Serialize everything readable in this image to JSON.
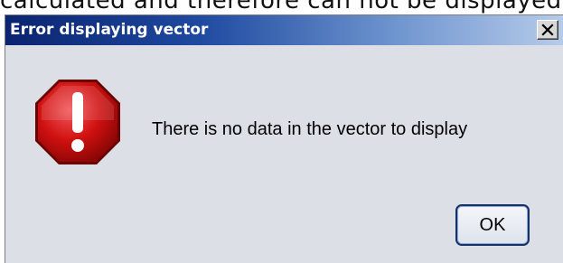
{
  "background": {
    "partial_text": "calculated and therefore can not be displayed"
  },
  "dialog": {
    "title": "Error displaying vector",
    "close_label": "×",
    "icon": "error-stop-icon",
    "message": "There is no data in the vector to display",
    "ok_label": "OK"
  },
  "colors": {
    "title_gradient_start": "#0a2470",
    "title_gradient_end": "#b6cbea",
    "error_icon_red": "#d01010",
    "dialog_background": "#dcdfe6"
  }
}
